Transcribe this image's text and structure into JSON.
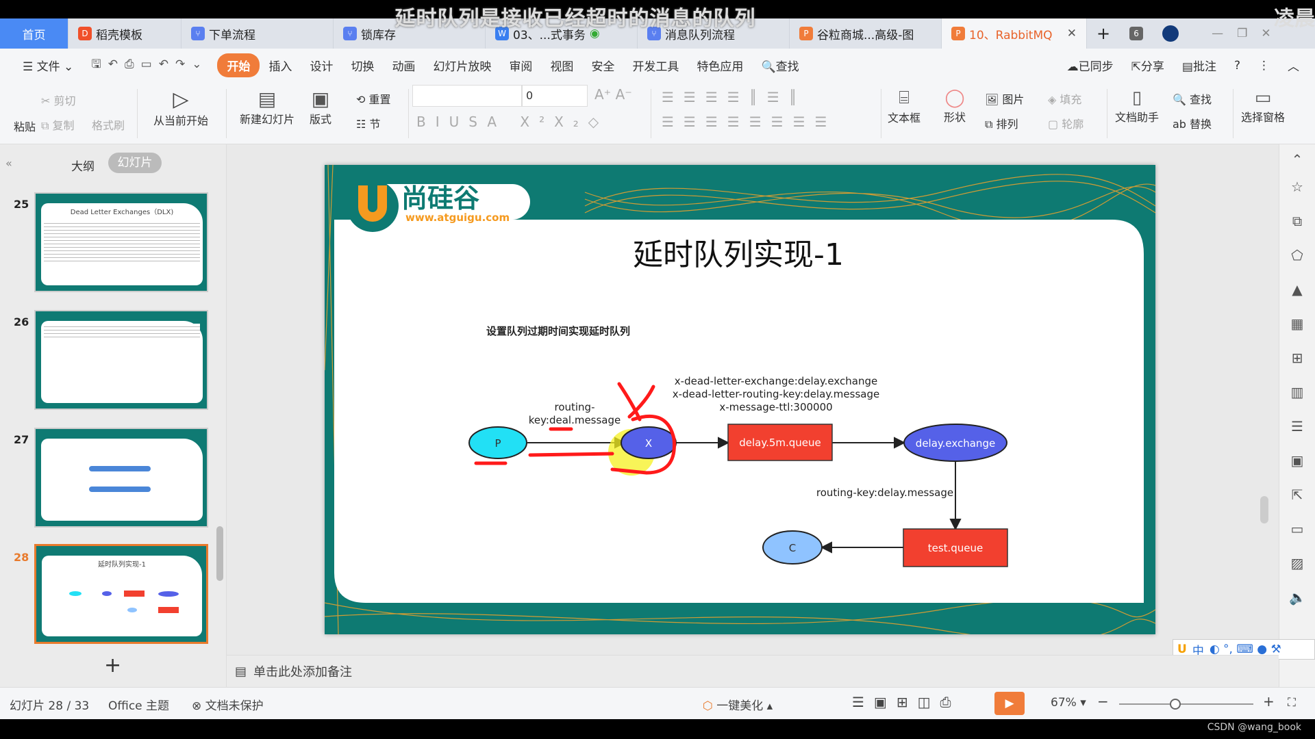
{
  "video_subtitle": "延时队列是接收已经超时的消息的队列",
  "video_subtitle_right": "凌晨",
  "tabs": [
    {
      "label": "首页",
      "type": "home"
    },
    {
      "label": "稻壳模板",
      "icon": "docer-icon",
      "color": "#f0502a"
    },
    {
      "label": "下单流程",
      "icon": "flowchart-icon",
      "color": "#5a7ff0"
    },
    {
      "label": "锁库存",
      "icon": "flowchart-icon",
      "color": "#5a7ff0"
    },
    {
      "label": "03、...式事务",
      "icon": "word-icon",
      "color": "#3a7ff0"
    },
    {
      "label": "消息队列流程",
      "icon": "flowchart-icon",
      "color": "#5a7ff0"
    },
    {
      "label": "谷粒商城...高级-图",
      "icon": "ppt-icon",
      "color": "#f07c3a"
    },
    {
      "label": "10、RabbitMQ",
      "icon": "ppt-icon",
      "color": "#f07c3a",
      "active": true
    }
  ],
  "tab_count": "6",
  "menu": {
    "file": "文件",
    "items": [
      "开始",
      "插入",
      "设计",
      "切换",
      "动画",
      "幻灯片放映",
      "审阅",
      "视图",
      "安全",
      "开发工具",
      "特色应用"
    ],
    "active": "开始",
    "search": "查找",
    "synced": "已同步",
    "share": "分享",
    "comment": "批注"
  },
  "ribbon": {
    "paste": "粘贴",
    "cut": "剪切",
    "copy": "复制",
    "format_painter": "格式刷",
    "play_from_current": "从当前开始",
    "new_slide": "新建幻灯片",
    "layout": "版式",
    "reset": "重置",
    "section": "节",
    "font_size": "0",
    "text_box": "文本框",
    "shape": "形状",
    "picture": "图片",
    "arrange": "排列",
    "fill": "填充",
    "outline": "轮廓",
    "doc_assistant": "文档助手",
    "find": "查找",
    "replace": "替换",
    "selection_pane": "选择窗格"
  },
  "left_panel": {
    "tab_outline": "大纲",
    "tab_slides": "幻灯片",
    "slides": [
      {
        "number": "25",
        "title": "Dead Letter Exchanges（DLX)"
      },
      {
        "number": "26",
        "title": ""
      },
      {
        "number": "27",
        "title": ""
      },
      {
        "number": "28",
        "title": "延时队列实现-1",
        "selected": true
      }
    ]
  },
  "slide": {
    "logo_text": "尚硅谷",
    "logo_url": "www.atguigu.com",
    "title": "延时队列实现-1",
    "subtitle": "设置队列过期时间实现延时队列",
    "nodes": {
      "producer": "P",
      "exchange_x": "X",
      "delay_queue": "delay.5m.queue",
      "delay_exchange": "delay.exchange",
      "test_queue": "test.queue",
      "consumer": "C"
    },
    "labels": {
      "routing_key_1a": "routing-",
      "routing_key_1b": "key:deal.message",
      "args_1": "x-dead-letter-exchange:delay.exchange",
      "args_2": "x-dead-letter-routing-key:delay.message",
      "args_3": "x-message-ttl:300000",
      "routing_key_2": "routing-key:delay.message"
    },
    "colors": {
      "producer": "#22e0f5",
      "exchange": "#5561e8",
      "queue": "#f2402f",
      "consumer": "#8fc3ff",
      "annotation": "#ff1a1a",
      "highlight": "#f5f020"
    }
  },
  "notes_placeholder": "单击此处添加备注",
  "status": {
    "slide_pos": "幻灯片 28 / 33",
    "theme": "Office 主题",
    "protection": "文档未保护",
    "beautify": "一键美化",
    "zoom": "67%",
    "zoom_level": 0.42
  },
  "ime": "中",
  "watermark": "CSDN @wang_book"
}
